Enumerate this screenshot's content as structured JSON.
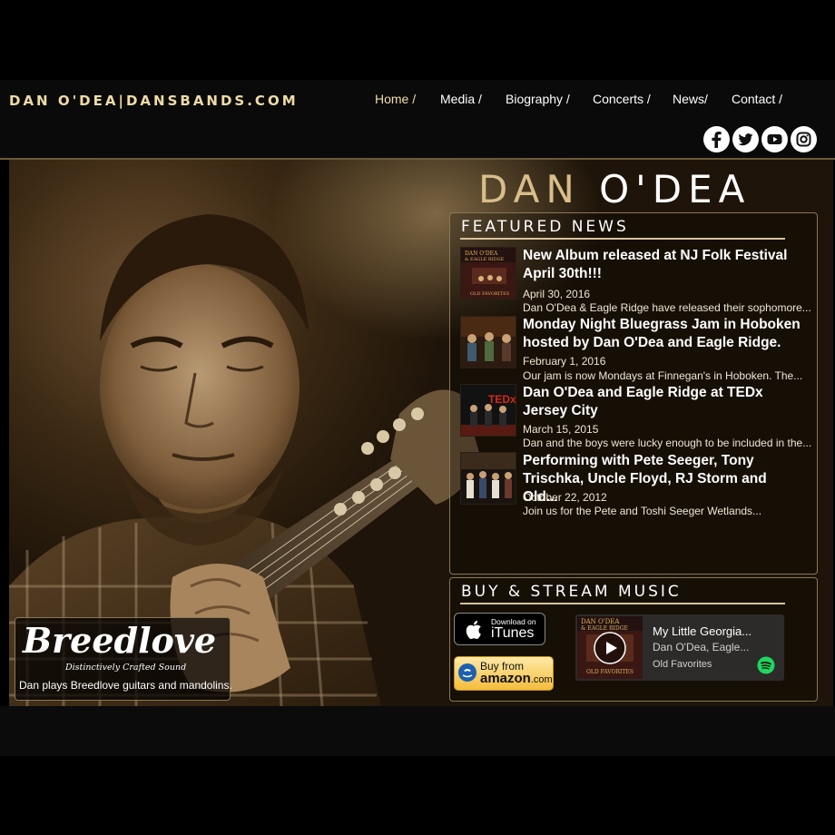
{
  "site": {
    "title": "DAN O'DEA|DANSBANDS.COM",
    "brand_first": "DAN",
    "brand_last": "O'DEA"
  },
  "nav": {
    "items": [
      {
        "label": "Home /",
        "active": true
      },
      {
        "label": "Media /",
        "active": false
      },
      {
        "label": "Biography /",
        "active": false
      },
      {
        "label": "Concerts /",
        "active": false
      },
      {
        "label": "News/",
        "active": false
      },
      {
        "label": "Contact /",
        "active": false
      }
    ]
  },
  "social": [
    "facebook-icon",
    "twitter-icon",
    "youtube-icon",
    "instagram-icon"
  ],
  "featured_news": {
    "heading": "FEATURED NEWS",
    "items": [
      {
        "title": "New Album released at NJ Folk Festival April 30th!!!",
        "date": "April 30, 2016",
        "excerpt": "Dan O'Dea & Eagle Ridge have released their sophomore..."
      },
      {
        "title": "Monday Night Bluegrass Jam in Hoboken hosted by Dan O'Dea and Eagle Ridge.",
        "date": "February 1, 2016",
        "excerpt": "Our jam is now Mondays at Finnegan's in Hoboken.  The..."
      },
      {
        "title": "Dan O'Dea and Eagle Ridge at TEDx Jersey City",
        "date": "March 15, 2015",
        "excerpt": "Dan and the boys were lucky enough to be included in the..."
      },
      {
        "title": "Performing with Pete Seeger, Tony Trischka, Uncle Floyd, RJ Storm and Old...",
        "date": "October 22, 2012",
        "excerpt": "Join us for the Pete and Toshi Seeger Wetlands..."
      }
    ]
  },
  "music": {
    "heading": "BUY & STREAM MUSIC",
    "itunes_small": "Download on",
    "itunes_big": "iTunes",
    "amazon_top": "Buy from",
    "amazon_main": "amazon",
    "amazon_suffix": ".com"
  },
  "player": {
    "track": "My Little Georgia...",
    "artist": "Dan O'Dea, Eagle...",
    "album": "Old Favorites"
  },
  "sponsor": {
    "logo": "Breedlove",
    "tagline": "Distinctively Crafted Sound",
    "caption": "Dan plays Breedlove guitars and mandolins."
  },
  "colors": {
    "accent_gold": "#d9bd8a",
    "nav_active": "#f1dcaa",
    "background": "#000000",
    "spotify_green": "#1ed760"
  }
}
